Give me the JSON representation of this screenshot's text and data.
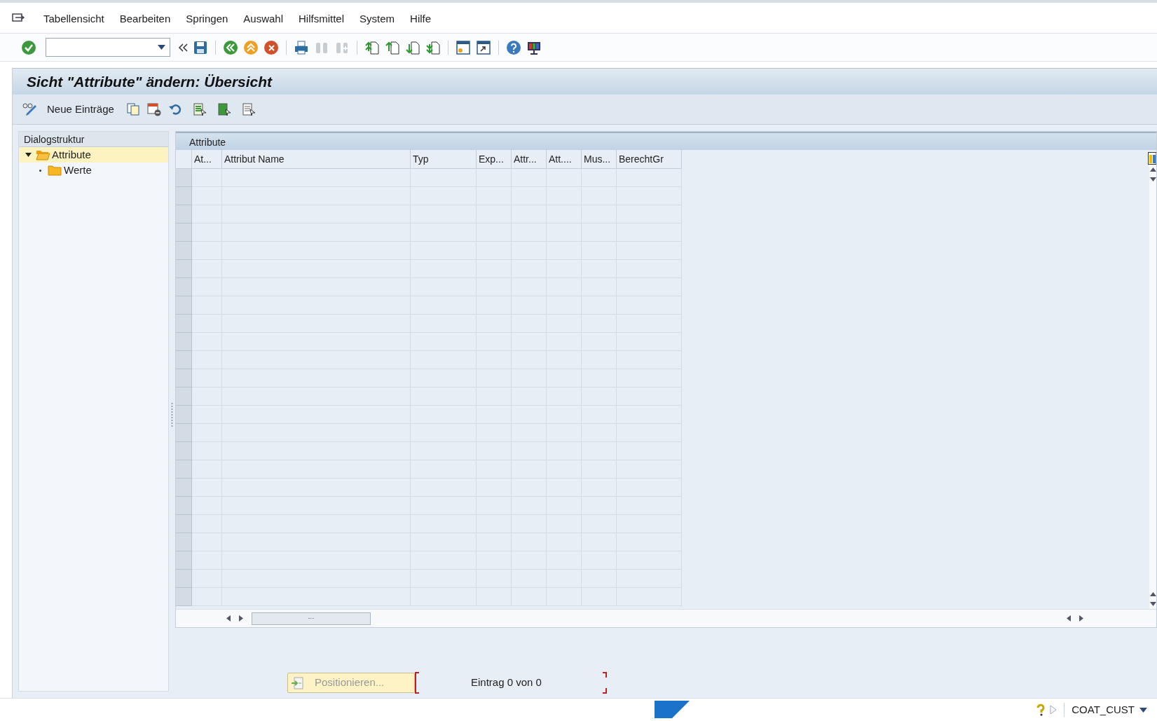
{
  "menu_bar": [
    "Tabellensicht",
    "Bearbeiten",
    "Springen",
    "Auswahl",
    "Hilfsmittel",
    "System",
    "Hilfe"
  ],
  "title": "Sicht \"Attribute\" ändern: Übersicht",
  "app_toolbar": {
    "new_entries": "Neue Einträge"
  },
  "dialog_structure": {
    "header": "Dialogstruktur",
    "items": [
      {
        "label": "Attribute",
        "selected": true,
        "expanded": true,
        "children": [
          {
            "label": "Werte",
            "selected": false
          }
        ]
      }
    ]
  },
  "table": {
    "title": "Attribute",
    "columns": [
      "At...",
      "Attribut Name",
      "Typ",
      "Exp...",
      "Attr...",
      "Att....",
      "Mus...",
      "BerechtGr"
    ]
  },
  "position_button": "Positionieren...",
  "entry_counter": "Eintrag 0 von 0",
  "status_bar": {
    "system": "COAT_CUST"
  }
}
